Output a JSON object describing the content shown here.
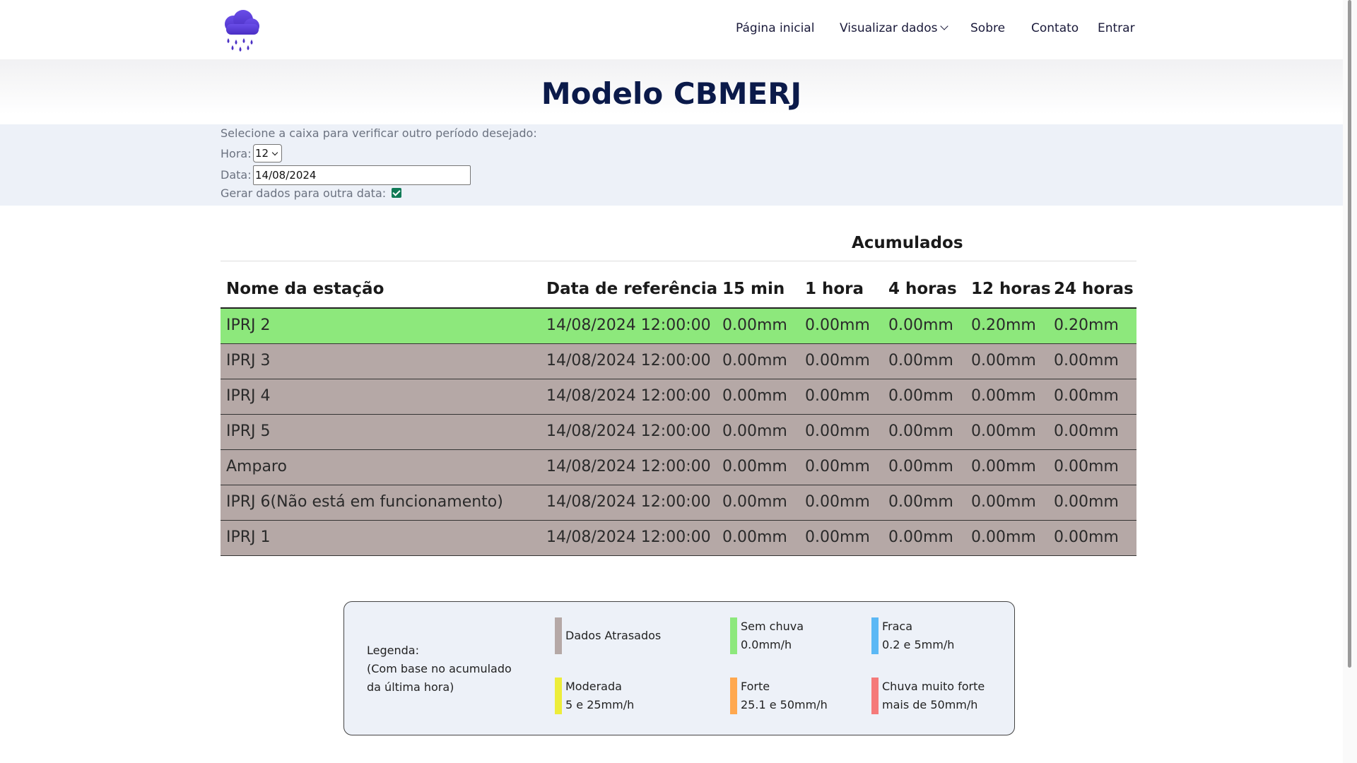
{
  "nav": {
    "items": [
      "Página inicial",
      "Visualizar dados",
      "Sobre",
      "Contato",
      "Entrar"
    ],
    "logo_icon": "rain-cloud-icon"
  },
  "page": {
    "title": "Modelo CBMERJ"
  },
  "filter": {
    "instruction": "Selecione a caixa para verificar outro período desejado:",
    "hour_label": "Hora:",
    "hour_value": "12",
    "date_label": "Data:",
    "date_value": "14/08/2024",
    "checkbox_label": "Gerar dados para outra data:",
    "checkbox_checked": true
  },
  "table": {
    "group_header": "Acumulados",
    "columns": [
      "Nome da estação",
      "Data de referência",
      "15 min",
      "1 hora",
      "4 horas",
      "12 horas",
      "24 horas"
    ],
    "rows": [
      {
        "cells": [
          "IPRJ 2",
          "14/08/2024 12:00:00",
          "0.00mm",
          "0.00mm",
          "0.00mm",
          "0.20mm",
          "0.20mm"
        ],
        "color": "#8de87c"
      },
      {
        "cells": [
          "IPRJ 3",
          "14/08/2024 12:00:00",
          "0.00mm",
          "0.00mm",
          "0.00mm",
          "0.00mm",
          "0.00mm"
        ],
        "color": "#b5a8a6"
      },
      {
        "cells": [
          "IPRJ 4",
          "14/08/2024 12:00:00",
          "0.00mm",
          "0.00mm",
          "0.00mm",
          "0.00mm",
          "0.00mm"
        ],
        "color": "#b5a8a6"
      },
      {
        "cells": [
          "IPRJ 5",
          "14/08/2024 12:00:00",
          "0.00mm",
          "0.00mm",
          "0.00mm",
          "0.00mm",
          "0.00mm"
        ],
        "color": "#b5a8a6"
      },
      {
        "cells": [
          "Amparo",
          "14/08/2024 12:00:00",
          "0.00mm",
          "0.00mm",
          "0.00mm",
          "0.00mm",
          "0.00mm"
        ],
        "color": "#b5a8a6"
      },
      {
        "cells": [
          "IPRJ 6(Não está em funcionamento)",
          "14/08/2024 12:00:00",
          "0.00mm",
          "0.00mm",
          "0.00mm",
          "0.00mm",
          "0.00mm"
        ],
        "color": "#b5a8a6"
      },
      {
        "cells": [
          "IPRJ 1",
          "14/08/2024 12:00:00",
          "0.00mm",
          "0.00mm",
          "0.00mm",
          "0.00mm",
          "0.00mm"
        ],
        "color": "#b5a8a6"
      }
    ]
  },
  "legend": {
    "title": "Legenda:",
    "note_line1": "(Com base no acumulado",
    "note_line2": "da última hora)",
    "items": [
      {
        "label": "Dados Atrasados",
        "range": "",
        "color": "#b5a8a6"
      },
      {
        "label": "Sem chuva",
        "range": "0.0mm/h",
        "color": "#8de87c"
      },
      {
        "label": "Fraca",
        "range": "0.2 e 5mm/h",
        "color": "#5bb8f5"
      },
      {
        "label": "Moderada",
        "range": "5 e 25mm/h",
        "color": "#eded3a"
      },
      {
        "label": "Forte",
        "range": "25.1 e 50mm/h",
        "color": "#ffa84f"
      },
      {
        "label": "Chuva muito forte",
        "range": "mais de 50mm/h",
        "color": "#f57a7a"
      }
    ]
  }
}
